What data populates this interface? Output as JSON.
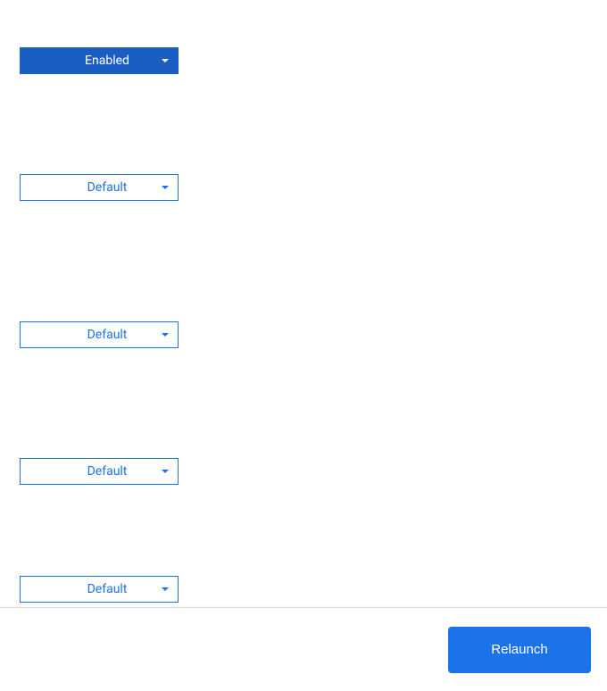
{
  "flags": {
    "dropdowns": [
      {
        "label": "Enabled",
        "state": "enabled"
      },
      {
        "label": "Default",
        "state": "default"
      },
      {
        "label": "Default",
        "state": "default"
      },
      {
        "label": "Default",
        "state": "default"
      },
      {
        "label": "Default",
        "state": "default"
      }
    ]
  },
  "footer": {
    "relaunch_label": "Relaunch"
  }
}
